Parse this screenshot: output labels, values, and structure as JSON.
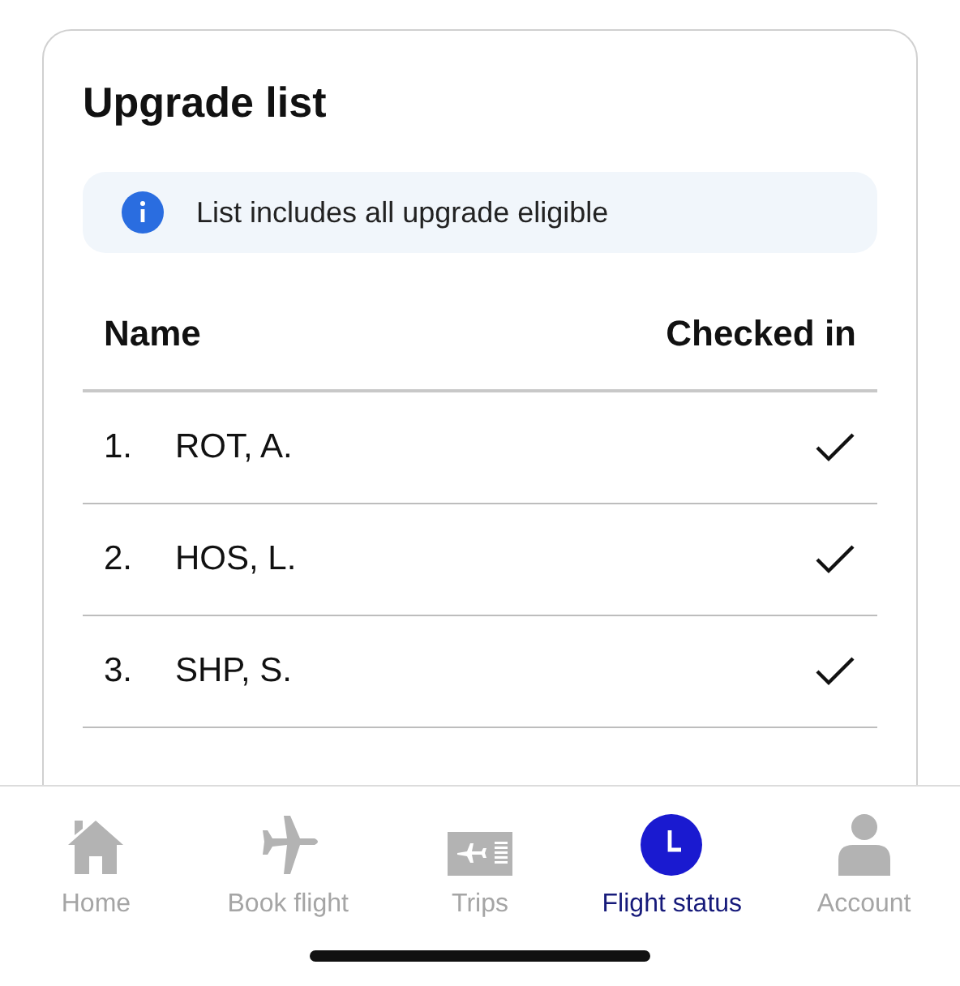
{
  "card": {
    "title": "Upgrade list",
    "notice": "List includes all upgrade eligible"
  },
  "table": {
    "columns": [
      "Name",
      "Checked in"
    ],
    "rows": [
      {
        "number": "1.",
        "name": "ROT, A.",
        "checked_in": true
      },
      {
        "number": "2.",
        "name": "HOS, L.",
        "checked_in": true
      },
      {
        "number": "3.",
        "name": "SHP, S.",
        "checked_in": true
      }
    ]
  },
  "tab_bar": [
    {
      "kind": "home",
      "label": "Home",
      "selected": false
    },
    {
      "kind": "plane",
      "label": "Book flight",
      "selected": false
    },
    {
      "kind": "ticket",
      "label": "Trips",
      "selected": false
    },
    {
      "kind": "clock",
      "label": "Flight status",
      "selected": true
    },
    {
      "kind": "person",
      "label": "Account",
      "selected": false
    }
  ]
}
